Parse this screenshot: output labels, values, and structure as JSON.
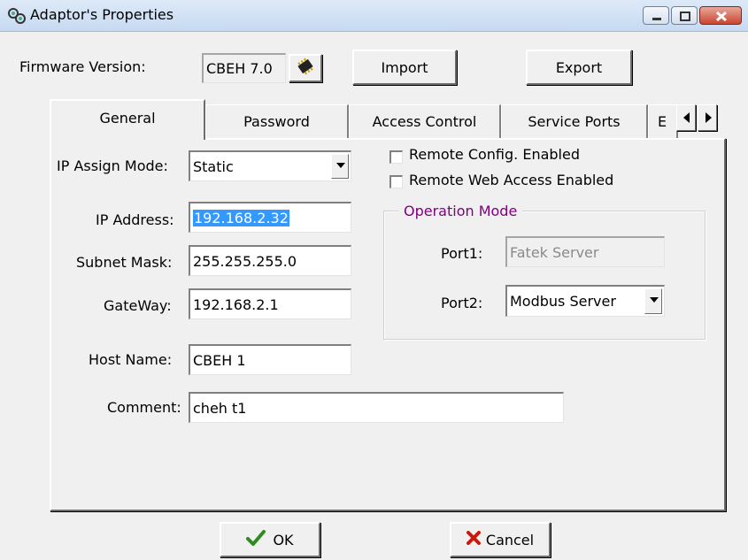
{
  "window": {
    "title": "Adaptor's Properties"
  },
  "firmware": {
    "label": "Firmware Version:",
    "value": "CBEH 7.0"
  },
  "toolbar": {
    "import_label": "Import",
    "export_label": "Export"
  },
  "tabs": [
    {
      "label": "General",
      "active": true
    },
    {
      "label": "Password",
      "active": false
    },
    {
      "label": "Access Control",
      "active": false
    },
    {
      "label": "Service Ports",
      "active": false
    },
    {
      "label": "E",
      "active": false
    }
  ],
  "general": {
    "ip_assign_mode": {
      "label": "IP Assign Mode:",
      "value": "Static"
    },
    "ip_address": {
      "label": "IP Address:",
      "value": "192.168.2.32"
    },
    "subnet_mask": {
      "label": "Subnet Mask:",
      "value": "255.255.255.0"
    },
    "gateway": {
      "label": "GateWay:",
      "value": "192.168.2.1"
    },
    "host_name": {
      "label": "Host Name:",
      "value": "CBEH 1"
    },
    "comment": {
      "label": "Comment:",
      "value": "cheh t1"
    },
    "remote_config": {
      "label": "Remote Config. Enabled",
      "checked": false
    },
    "remote_web": {
      "label": "Remote Web Access Enabled",
      "checked": false
    },
    "operation_mode": {
      "title": "Operation Mode",
      "port1": {
        "label": "Port1:",
        "value": "Fatek Server"
      },
      "port2": {
        "label": "Port2:",
        "value": "Modbus Server"
      }
    }
  },
  "footer": {
    "ok_label": "OK",
    "cancel_label": "Cancel"
  },
  "colors": {
    "group_title": "#800080",
    "selection": "#3399ff",
    "ok_check": "#2e8b1f",
    "cancel_x": "#cc1a0a"
  }
}
